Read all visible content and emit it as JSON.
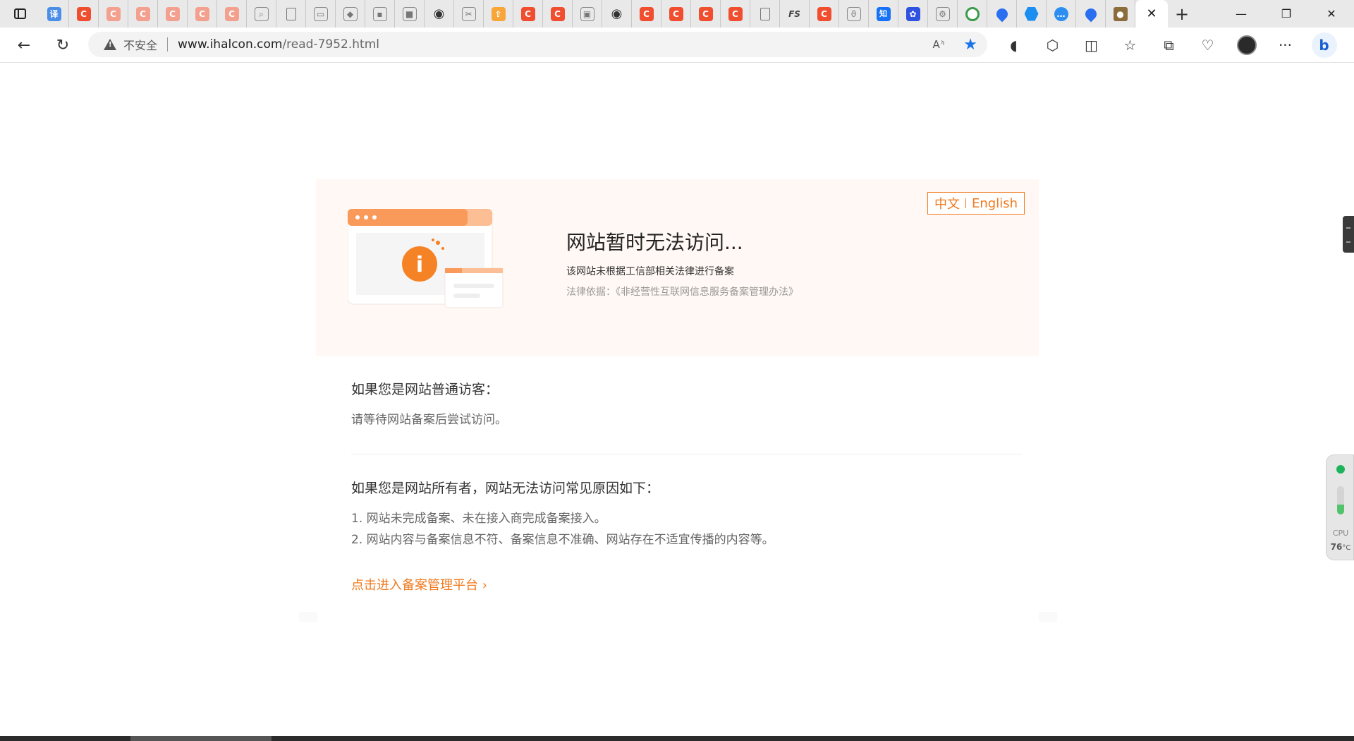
{
  "browser": {
    "tabs": [
      {
        "icon": "translate-icon",
        "glyph": "译",
        "style": "blue"
      },
      {
        "icon": "csdn-icon",
        "glyph": "C",
        "style": "c"
      },
      {
        "icon": "csdn-icon",
        "glyph": "C",
        "style": "c-faded"
      },
      {
        "icon": "csdn-icon",
        "glyph": "C",
        "style": "c-faded"
      },
      {
        "icon": "csdn-icon",
        "glyph": "C",
        "style": "c-faded"
      },
      {
        "icon": "csdn-icon",
        "glyph": "C",
        "style": "c-faded"
      },
      {
        "icon": "csdn-icon",
        "glyph": "C",
        "style": "c-faded"
      },
      {
        "icon": "search-icon",
        "glyph": "⌕",
        "style": "gray"
      },
      {
        "icon": "page-icon",
        "glyph": "",
        "style": "doc"
      },
      {
        "icon": "bilibili-icon",
        "glyph": "▭",
        "style": "gray"
      },
      {
        "icon": "diamond-icon",
        "glyph": "◆",
        "style": "gray"
      },
      {
        "icon": "pixel-icon",
        "glyph": "▪",
        "style": "gray"
      },
      {
        "icon": "dark-box-icon",
        "glyph": "■",
        "style": "gray"
      },
      {
        "icon": "github-icon",
        "glyph": "◉",
        "style": "github"
      },
      {
        "icon": "link-icon",
        "glyph": "✂",
        "style": "gray"
      },
      {
        "icon": "arrow-icon",
        "glyph": "⇧",
        "style": "orange"
      },
      {
        "icon": "csdn-icon",
        "glyph": "C",
        "style": "c"
      },
      {
        "icon": "csdn-icon",
        "glyph": "C",
        "style": "c"
      },
      {
        "icon": "bilibili-tv-icon",
        "glyph": "▣",
        "style": "gray"
      },
      {
        "icon": "github-icon",
        "glyph": "◉",
        "style": "github"
      },
      {
        "icon": "csdn-icon",
        "glyph": "C",
        "style": "c"
      },
      {
        "icon": "csdn-icon",
        "glyph": "C",
        "style": "c"
      },
      {
        "icon": "csdn-icon",
        "glyph": "C",
        "style": "c"
      },
      {
        "icon": "csdn-icon",
        "glyph": "C",
        "style": "c"
      },
      {
        "icon": "page-icon",
        "glyph": "",
        "style": "doc"
      },
      {
        "icon": "fs-icon",
        "glyph": "FS",
        "style": "fs"
      },
      {
        "icon": "csdn-icon",
        "glyph": "C",
        "style": "c"
      },
      {
        "icon": "curl-icon",
        "glyph": "ϑ",
        "style": "gray"
      },
      {
        "icon": "zhihu-icon",
        "glyph": "知",
        "style": "zhi"
      },
      {
        "icon": "baidu-paw-icon",
        "glyph": "✿",
        "style": "paw"
      },
      {
        "icon": "tool-icon",
        "glyph": "⚙",
        "style": "gray"
      },
      {
        "icon": "ring-icon",
        "glyph": "",
        "style": "green-ring"
      },
      {
        "icon": "drop-icon",
        "glyph": "",
        "style": "drop"
      },
      {
        "icon": "hex-icon",
        "glyph": "",
        "style": "hex"
      },
      {
        "icon": "chat-icon",
        "glyph": "…",
        "style": "chat"
      },
      {
        "icon": "drop-icon",
        "glyph": "",
        "style": "drop"
      },
      {
        "icon": "bird-icon",
        "glyph": "●",
        "style": "bird"
      }
    ],
    "active_tab_close": "✕",
    "new_tab": "+",
    "window_controls": {
      "minimize": "—",
      "restore": "❐",
      "close": "✕"
    },
    "omnibox": {
      "security_label": "不安全",
      "url_host": "www.ihalcon.com",
      "url_path": "/read-7952.html",
      "read_aloud": "A⸅",
      "favorite": "★"
    },
    "toolbar_icons": [
      "mouse-icon",
      "extensions-icon",
      "split-screen-icon",
      "favorites-icon",
      "collections-icon",
      "performance-icon",
      "profile-avatar",
      "more-icon",
      "bing-icon"
    ],
    "toolbar_glyphs": {
      "mouse": "◖",
      "extensions": "⬡",
      "split": "◫",
      "favorites": "☆",
      "collections": "⧉",
      "performance": "♡",
      "more": "···",
      "bing": "b"
    }
  },
  "banner": {
    "lang_zh": "中文",
    "lang_en": "English",
    "title": "网站暂时无法访问...",
    "subtitle": "该网站未根据工信部相关法律进行备案",
    "law": "法律依据：《非经营性互联网信息服务备案管理办法》",
    "info_glyph": "i"
  },
  "visitor": {
    "heading": "如果您是网站普通访客：",
    "text": "请等待网站备案后尝试访问。"
  },
  "owner": {
    "heading": "如果您是网站所有者，网站无法访问常见原因如下：",
    "reasons": [
      "1. 网站未完成备案、未在接入商完成备案接入。",
      "2. 网站内容与备案信息不符、备案信息不准确、网站存在不适宜传播的内容等。"
    ],
    "link": "点击进入备案管理平台 ›"
  },
  "cpu_widget": {
    "label": "CPU",
    "temperature": "76",
    "unit": "°C",
    "load_fraction": 0.35
  },
  "colors": {
    "accent": "#f07a1e",
    "banner_bg": "#fff8f4",
    "csdn_red": "#f04e2f",
    "edge_blue": "#1a73e8",
    "status_green": "#1db35a"
  }
}
